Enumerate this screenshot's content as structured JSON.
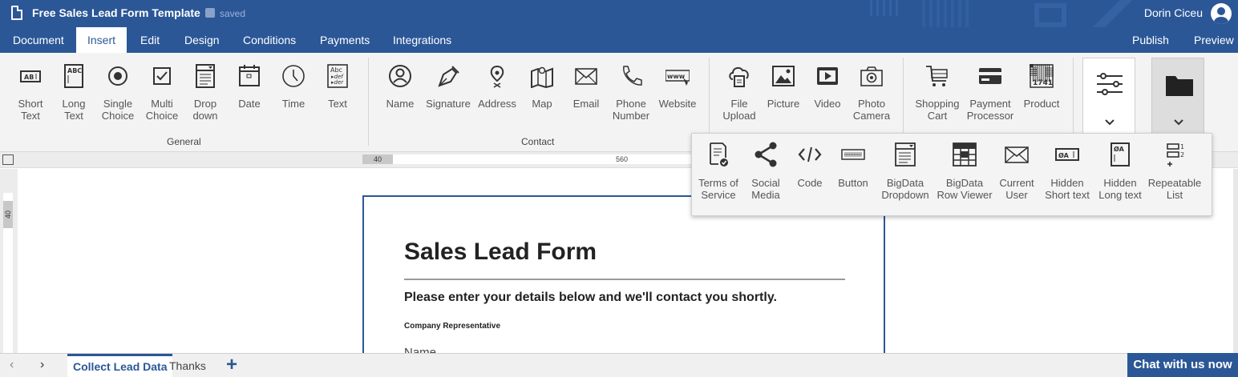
{
  "header": {
    "doc_title": "Free Sales Lead Form Template",
    "save_status": "saved",
    "user_name": "Dorin Ciceu"
  },
  "menu": {
    "tabs": [
      "Document",
      "Insert",
      "Edit",
      "Design",
      "Conditions",
      "Payments",
      "Integrations"
    ],
    "active_tab": "Insert",
    "publish": "Publish",
    "preview": "Preview"
  },
  "ribbon": {
    "general": {
      "label": "General",
      "items": [
        {
          "label": "Short\nText",
          "icon": "short-text-icon"
        },
        {
          "label": "Long\nText",
          "icon": "long-text-icon"
        },
        {
          "label": "Single\nChoice",
          "icon": "radio-icon"
        },
        {
          "label": "Multi\nChoice",
          "icon": "checkbox-icon"
        },
        {
          "label": "Drop\ndown",
          "icon": "dropdown-icon"
        },
        {
          "label": "Date",
          "icon": "calendar-icon"
        },
        {
          "label": "Time",
          "icon": "clock-icon"
        },
        {
          "label": "Text",
          "icon": "text-block-icon"
        }
      ]
    },
    "contact": {
      "label": "Contact",
      "items": [
        {
          "label": "Name",
          "icon": "person-icon"
        },
        {
          "label": "Signature",
          "icon": "pen-icon"
        },
        {
          "label": "Address",
          "icon": "location-pin-icon"
        },
        {
          "label": "Map",
          "icon": "map-icon"
        },
        {
          "label": "Email",
          "icon": "envelope-icon"
        },
        {
          "label": "Phone\nNumber",
          "icon": "phone-icon"
        },
        {
          "label": "Website",
          "icon": "www-icon"
        }
      ]
    },
    "media": {
      "items": [
        {
          "label": "File\nUpload",
          "icon": "cloud-upload-icon"
        },
        {
          "label": "Picture",
          "icon": "image-icon"
        },
        {
          "label": "Video",
          "icon": "video-icon"
        },
        {
          "label": "Photo\nCamera",
          "icon": "camera-icon"
        }
      ]
    },
    "commerce": {
      "items": [
        {
          "label": "Shopping\nCart",
          "icon": "cart-icon"
        },
        {
          "label": "Payment\nProcessor",
          "icon": "credit-card-icon"
        },
        {
          "label": "Product",
          "icon": "barcode-icon"
        }
      ]
    }
  },
  "dropdown": {
    "items": [
      {
        "label": "Terms of\nService",
        "icon": "terms-icon"
      },
      {
        "label": "Social\nMedia",
        "icon": "share-icon"
      },
      {
        "label": "Code",
        "icon": "code-icon"
      },
      {
        "label": "Button",
        "icon": "button-icon"
      },
      {
        "label": "BigData\nDropdown",
        "icon": "bigdata-dropdown-icon"
      },
      {
        "label": "BigData\nRow Viewer",
        "icon": "table-icon"
      },
      {
        "label": "Current\nUser",
        "icon": "envelope-icon"
      },
      {
        "label": "Hidden\nShort text",
        "icon": "hidden-short-icon"
      },
      {
        "label": "Hidden\nLong text",
        "icon": "hidden-long-icon"
      },
      {
        "label": "Repeatable\nList",
        "icon": "repeat-list-icon"
      }
    ]
  },
  "ruler": {
    "start": "40",
    "middle": "560",
    "left": "40"
  },
  "form": {
    "title": "Sales Lead Form",
    "subtitle": "Please enter your details below and we'll contact you shortly.",
    "section": "Company Representative",
    "first_field": "Name"
  },
  "pages": {
    "tabs": [
      "Collect Lead Data",
      "Thanks"
    ],
    "active": "Collect Lead Data"
  },
  "chat": "Chat with us now",
  "colors": {
    "brand": "#2b5797"
  }
}
